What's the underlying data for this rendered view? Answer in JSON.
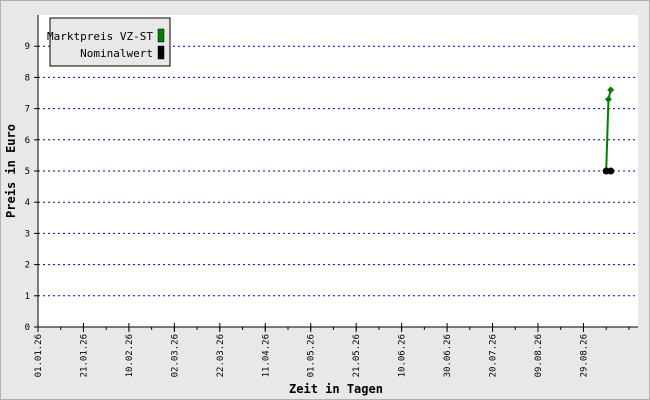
{
  "chart_data": {
    "type": "line",
    "xlabel": "Zeit in Tagen",
    "ylabel": "Preis in Euro",
    "ylim": [
      0,
      10
    ],
    "yticks": [
      0,
      1,
      2,
      3,
      4,
      5,
      6,
      7,
      8,
      9
    ],
    "xlim": [
      "2026-01-01",
      "2026-09-22"
    ],
    "xticks": [
      "01.01.26",
      "21.01.26",
      "10.02.26",
      "02.03.26",
      "22.03.26",
      "11.04.26",
      "01.05.26",
      "21.05.26",
      "10.06.26",
      "30.06.26",
      "20.07.26",
      "09.08.26",
      "29.08.26"
    ],
    "xtick_dates": [
      "2026-01-01",
      "2026-01-21",
      "2026-02-10",
      "2026-03-02",
      "2026-03-22",
      "2026-04-11",
      "2026-05-01",
      "2026-05-21",
      "2026-06-10",
      "2026-06-30",
      "2026-07-20",
      "2026-08-09",
      "2026-08-29"
    ],
    "minor_tick_days": 10,
    "grid": true,
    "legend_position": "top-left",
    "series": [
      {
        "name": "Marktpreis VZ-ST",
        "color": "#008000",
        "marker": "diamond",
        "points": [
          [
            "2026-09-08",
            5.0
          ],
          [
            "2026-09-09",
            7.3
          ],
          [
            "2026-09-10",
            7.6
          ]
        ]
      },
      {
        "name": "Nominalwert",
        "color": "#000000",
        "marker": "circle",
        "points": [
          [
            "2026-09-08",
            5.0
          ],
          [
            "2026-09-10",
            5.0
          ]
        ]
      }
    ]
  }
}
